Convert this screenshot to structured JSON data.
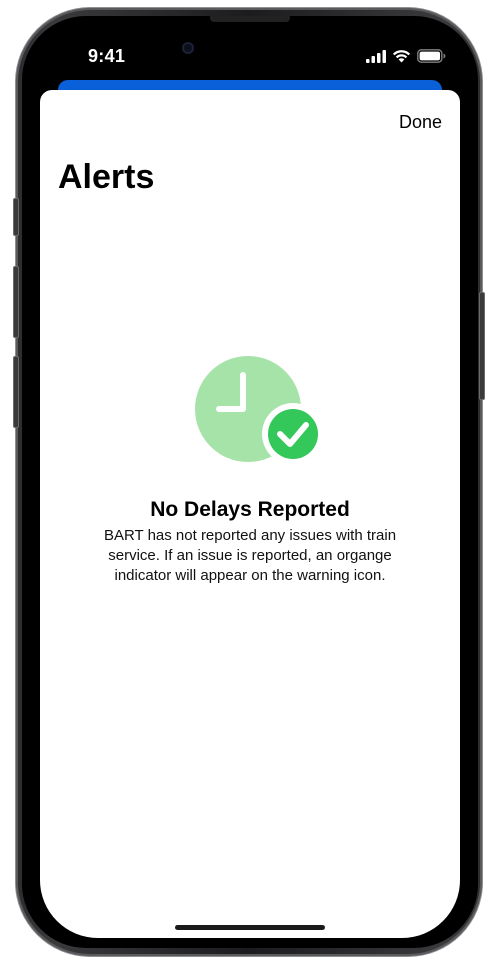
{
  "status_bar": {
    "time": "9:41",
    "icons": [
      "cellular-signal-icon",
      "wifi-icon",
      "battery-icon"
    ]
  },
  "header": {
    "done_label": "Done",
    "title": "Alerts"
  },
  "empty_state": {
    "icon": "clock-checkmark-icon",
    "title": "No Delays Reported",
    "message": "BART has not reported any issues with train service. If an issue is reported, an organge indicator will appear on the warning icon."
  },
  "colors": {
    "clock_green": "#a6e3a8",
    "check_green": "#34c759",
    "peek_blue": "#0a60d8"
  }
}
